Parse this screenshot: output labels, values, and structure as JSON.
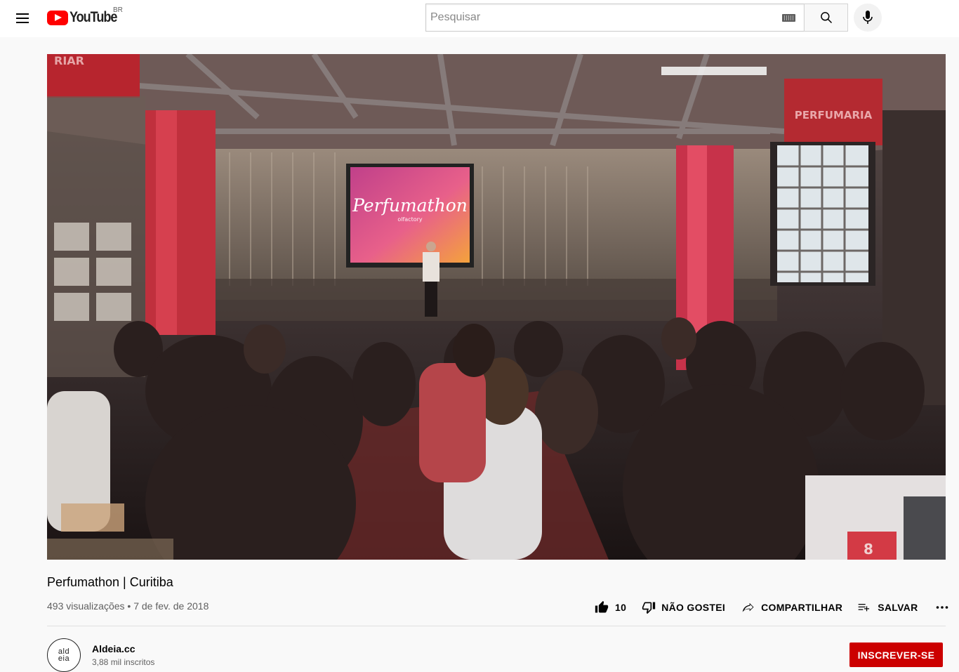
{
  "masthead": {
    "logo_text": "YouTube",
    "country_code": "BR",
    "search_placeholder": "Pesquisar",
    "search_value": ""
  },
  "player": {
    "screen_title": "Perfumathon",
    "screen_subtitle": "olfactory",
    "banner_text": "PERFUMARIA",
    "banner_left_text": "RIAR",
    "table_number": "8"
  },
  "video": {
    "title": "Perfumathon | Curitiba",
    "meta": "493 visualizações • 7 de fev. de 2018",
    "like_count": "10",
    "dislike_label": "NÃO GOSTEI",
    "share_label": "COMPARTILHAR",
    "save_label": "SALVAR"
  },
  "channel": {
    "name": "Aldeia.cc",
    "subscribers": "3,88 mil inscritos",
    "avatar_line1": "ald",
    "avatar_line2": "eia",
    "subscribe_label": "INSCREVER-SE"
  },
  "colors": {
    "brand_red": "#ff0000",
    "subscribe_red": "#cc0000",
    "text_primary": "#030303",
    "text_secondary": "#606060"
  },
  "icons": [
    "menu-icon",
    "youtube-logo-icon",
    "keyboard-icon",
    "search-icon",
    "mic-icon",
    "like-icon",
    "dislike-icon",
    "share-icon",
    "save-playlist-icon",
    "more-icon"
  ]
}
